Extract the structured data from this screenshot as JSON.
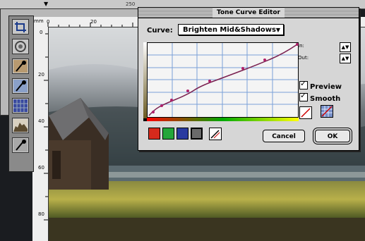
{
  "top_strip": {
    "ruler_number": "250"
  },
  "dialog": {
    "title": "Tone Curve Editor",
    "curve_label": "Curve:",
    "curve_value": "Brighten Mid&Shadows",
    "in_label": "In:",
    "out_label": "Out:",
    "preview_label": "Preview",
    "smooth_label": "Smooth",
    "preview_checked": true,
    "smooth_checked": true,
    "cancel_label": "Cancel",
    "ok_label": "OK",
    "channel_colors": [
      "#d62a1c",
      "#24a63a",
      "#2a3aa0",
      "#6a6a6a"
    ],
    "curve_color": "#7a2050",
    "point_color": "#b0206a"
  },
  "ruler": {
    "top_labels": [
      "mm",
      "0",
      "20"
    ],
    "left_labels": [
      "0",
      "20",
      "40",
      "60",
      "80"
    ]
  },
  "tools": [
    {
      "name": "crop-tool"
    },
    {
      "name": "target-tool"
    },
    {
      "name": "eyedropper-tool"
    },
    {
      "name": "eyedropper-tool-2"
    },
    {
      "name": "grid-tool"
    },
    {
      "name": "histogram-tool"
    },
    {
      "name": "eyedropper-tool-3"
    }
  ]
}
